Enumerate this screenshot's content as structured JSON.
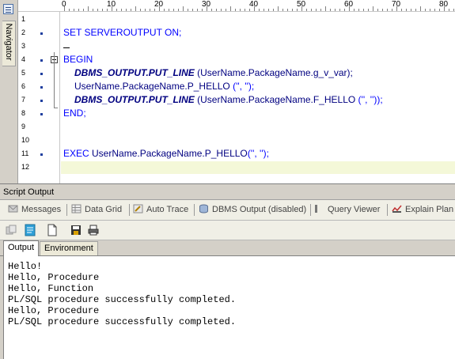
{
  "navigator": {
    "label": "Navigator"
  },
  "ruler": {
    "marks": [
      "0",
      "10",
      "20",
      "30",
      "40",
      "50",
      "60",
      "70",
      "80"
    ]
  },
  "editor": {
    "line_numbers": [
      "1",
      "2",
      "3",
      "4",
      "5",
      "6",
      "7",
      "8",
      "9",
      "10",
      "11",
      "12"
    ],
    "line2": {
      "kw": "SET SERVEROUTPUT ON;"
    },
    "line4": {
      "kw": "BEGIN"
    },
    "line5": {
      "pkg": "DBMS_OUTPUT.PUT_LINE",
      "args": " (UserName.PackageName.g_v_var);"
    },
    "line6": {
      "call": "UserName.PackageName.P_HELLO",
      "args": " ('', '');"
    },
    "line7": {
      "pkg": "DBMS_OUTPUT.PUT_LINE",
      "args_a": " (UserName.PackageName.F_HELLO ",
      "args_b": "('', ''));"
    },
    "line8": {
      "kw": "END;"
    },
    "line11": {
      "kw": "EXEC ",
      "call": "UserName.PackageName.P_HELLO",
      "args": "('', '');"
    }
  },
  "script_output": {
    "title": "Script Output",
    "tabs": [
      {
        "label": "Messages",
        "icon": "messages-icon"
      },
      {
        "label": "Data Grid",
        "icon": "grid-icon"
      },
      {
        "label": "Auto Trace",
        "icon": "trace-icon"
      },
      {
        "label": "DBMS Output (disabled)",
        "icon": "dbms-icon"
      },
      {
        "label": "Query Viewer",
        "icon": "query-icon"
      },
      {
        "label": "Explain Plan",
        "icon": "explain-icon"
      }
    ],
    "toolbar": [
      "copy-icon",
      "paste-script-icon",
      "new-page-icon",
      "save-icon",
      "print-icon"
    ],
    "sub_tabs": {
      "output": "Output",
      "environment": "Environment"
    },
    "output_lines": [
      "Hello!",
      "Hello, Procedure",
      "Hello, Function",
      "PL/SQL procedure successfully completed.",
      "Hello, Procedure",
      "PL/SQL procedure successfully completed."
    ]
  },
  "colors": {
    "keyword": "#0000ff",
    "package": "#000080",
    "current_line": "#f4f8d8"
  }
}
